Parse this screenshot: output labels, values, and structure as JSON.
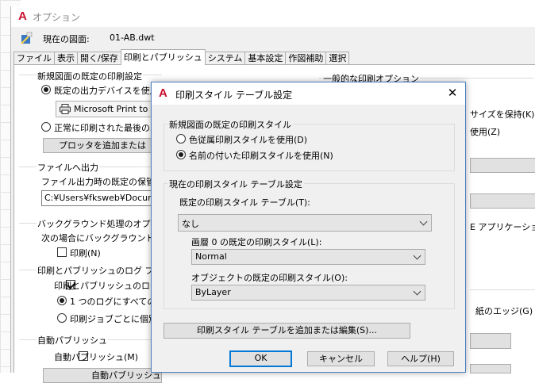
{
  "options_window": {
    "title": "オプション",
    "current_drawing_label": "現在の図面:",
    "current_drawing_name": "01-AB.dwt",
    "tabs": [
      "ファイル",
      "表示",
      "開く/保存",
      "印刷とパブリッシュ",
      "システム",
      "基本設定",
      "作図補助",
      "選択"
    ],
    "active_tab_index": 3,
    "sections": {
      "default_output": {
        "title": "新規図面の既定の印刷設定",
        "radio_use_device": "既定の出力デバイスを使用",
        "device_name": "Microsoft Print to F",
        "radio_last_used": "正常に印刷された最後の印",
        "add_button": "プロッタを追加または"
      },
      "file_output": {
        "title": "ファイルへ出力",
        "location_label": "ファイル出力時の既定の保管場",
        "path": "C:¥Users¥fksweb¥Documen"
      },
      "background": {
        "title": "バックグラウンド処理のオプション",
        "desc": "次の場合にバックグラウンド処理",
        "check_plot": "印刷(N)"
      },
      "log": {
        "title": "印刷とパブリッシュのログ ファイル",
        "check_log": "印刷とパブリッシュのログ フ",
        "radio_one_log": "1 つのログにすべての印",
        "radio_per_job": "印刷ジョブごとに個別の"
      },
      "auto_publish": {
        "title": "自動パブリッシュ",
        "check_auto": "自動パブリッシュ(M)",
        "button": "自動パブリッシュ"
      },
      "general": {
        "title": "一般的な印刷オプション",
        "item_keep_size": "サイズを保持(K)",
        "item_use": "使用(Z)",
        "item_ole": "E アプリケーションを",
        "item_paper_edge": "紙のエッジ(G)"
      }
    }
  },
  "dialog": {
    "title": "印刷スタイル テーブル設定",
    "close_glyph": "✕",
    "new_drawing_group": {
      "legend": "新規図面の既定の印刷スタイル",
      "radio_color": "色従属印刷スタイルを使用(D)",
      "radio_named": "名前の付いた印刷スタイルを使用(N)",
      "selected": "named"
    },
    "current_group": {
      "legend": "現在の印刷スタイル テーブル設定",
      "table_label": "既定の印刷スタイル テーブル(T):",
      "table_value": "なし",
      "layer0_label": "画層 0 の既定の印刷スタイル(L):",
      "layer0_value": "Normal",
      "object_label": "オブジェクトの既定の印刷スタイル(O):",
      "object_value": "ByLayer"
    },
    "add_edit_button": "印刷スタイル テーブルを追加または編集(S)...",
    "ok": "OK",
    "cancel": "キャンセル",
    "help": "ヘルプ(H)"
  },
  "colors": {
    "autocad_red": "#c8102e",
    "dialog_border": "#4a7fc1",
    "focus_blue": "#0078d7"
  }
}
